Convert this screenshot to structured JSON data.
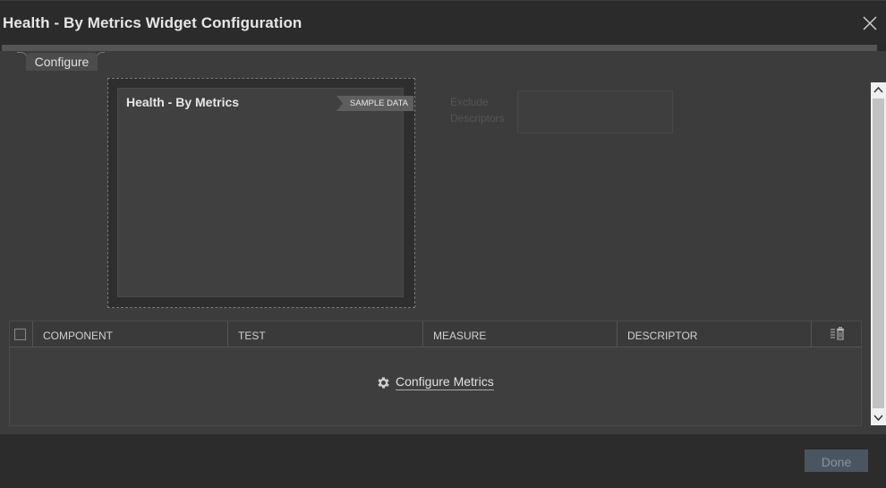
{
  "dialog": {
    "title": "Health - By Metrics Widget Configuration",
    "close_icon": "close-icon"
  },
  "tabs": [
    {
      "label": "Configure",
      "active": true
    }
  ],
  "preview": {
    "widget_title": "Health - By Metrics",
    "badge": "SAMPLE DATA"
  },
  "exclude": {
    "label": "Exclude Descriptors",
    "value": ""
  },
  "grid": {
    "columns": [
      "COMPONENT",
      "TEST",
      "MEASURE",
      "DESCRIPTOR"
    ],
    "column_action_icon": "columns-delete-icon",
    "empty_action": {
      "icon": "gear-icon",
      "label": "Configure Metrics"
    }
  },
  "footer": {
    "done_label": "Done",
    "done_enabled": false
  },
  "colors": {
    "background": "#3c3c3c",
    "titlebar": "#2b2b2b",
    "done_button": "#4b5561"
  }
}
